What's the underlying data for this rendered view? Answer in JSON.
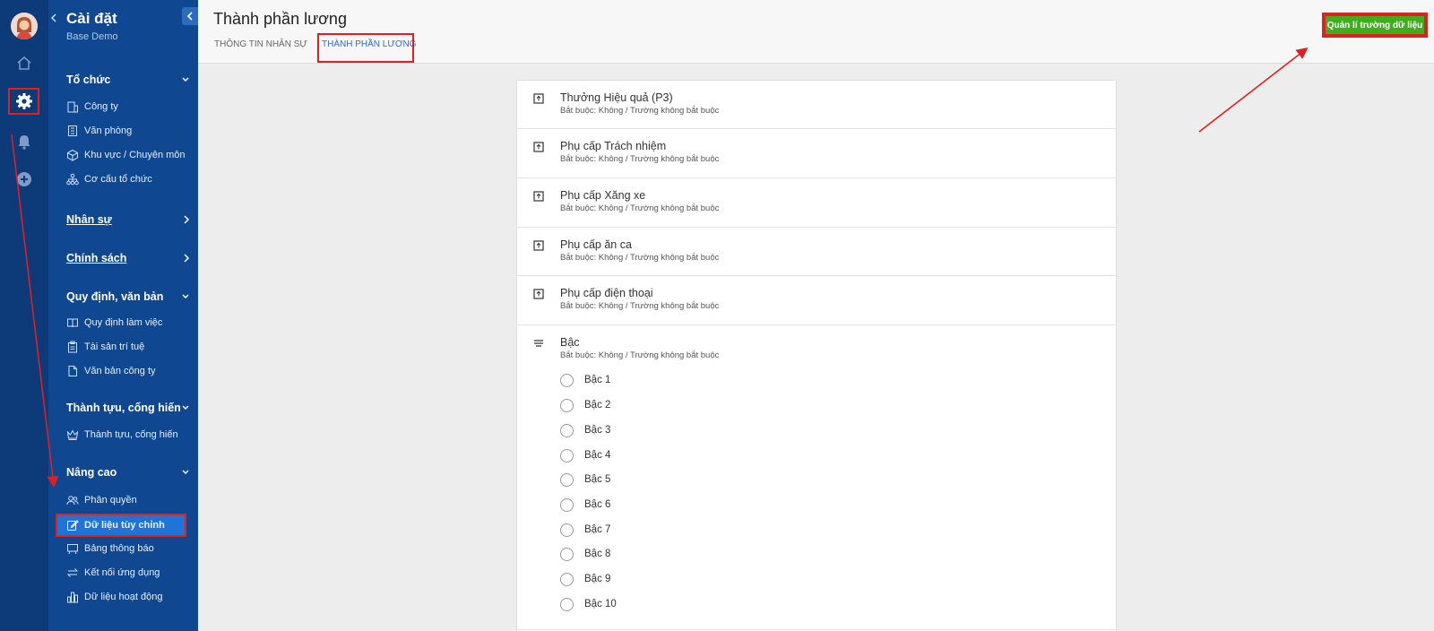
{
  "colors": {
    "rail": "#0d3b7a",
    "sidebar": "#0f4790",
    "accent": "#1e74d8",
    "button": "#3fae1b",
    "highlight": "#e02020"
  },
  "rail": {
    "icons": [
      "avatar",
      "home-icon",
      "gear-icon",
      "bell-icon",
      "plus-circle-icon"
    ]
  },
  "sidebar": {
    "title": "Cài đặt",
    "subtitle": "Base Demo",
    "sections": {
      "org": {
        "label": "Tổ chức",
        "items": [
          "Công ty",
          "Văn phòng",
          "Khu vực / Chuyên môn",
          "Cơ cấu tổ chức"
        ]
      },
      "hr": {
        "label": "Nhân sự"
      },
      "policy": {
        "label": "Chính sách"
      },
      "rules": {
        "label": "Quy định, văn bản",
        "items": [
          "Quy định làm việc",
          "Tài sản trí tuệ",
          "Văn bản công ty"
        ]
      },
      "achieve": {
        "label": "Thành tựu, cống hiến",
        "items": [
          "Thành tựu, cống hiến"
        ]
      },
      "advanced": {
        "label": "Nâng cao",
        "items": [
          "Phân quyền",
          "Dữ liệu tùy chỉnh",
          "Bảng thông báo",
          "Kết nối ứng dụng",
          "Dữ liệu hoạt động"
        ]
      }
    }
  },
  "header": {
    "title": "Thành phần lương",
    "tabs": [
      "THÔNG TIN NHÂN SỰ",
      "THÀNH PHẦN LƯƠNG"
    ],
    "active_tab": "THÀNH PHẦN LƯƠNG",
    "manage_button": "Quản lí trường dữ liệu"
  },
  "fields": [
    {
      "name": "Thưởng Hiệu quả (P3)",
      "sub": "Bắt buộc: Không / Trường không bắt buộc",
      "icon": "number-field-icon"
    },
    {
      "name": "Phụ cấp Trách nhiệm",
      "sub": "Bắt buộc: Không / Trường không bắt buộc",
      "icon": "number-field-icon"
    },
    {
      "name": "Phụ cấp Xăng xe",
      "sub": "Bắt buộc: Không / Trường không bắt buộc",
      "icon": "number-field-icon"
    },
    {
      "name": "Phụ cấp ăn ca",
      "sub": "Bắt buộc: Không / Trường không bắt buộc",
      "icon": "number-field-icon"
    },
    {
      "name": "Phụ cấp điện thoại",
      "sub": "Bắt buộc: Không / Trường không bắt buộc",
      "icon": "number-field-icon"
    },
    {
      "name": "Bậc",
      "sub": "Bắt buộc: Không / Trường không bắt buộc",
      "icon": "list-field-icon",
      "options": [
        "Bậc 1",
        "Bậc 2",
        "Bậc 3",
        "Bậc 4",
        "Bậc 5",
        "Bậc 6",
        "Bậc 7",
        "Bậc 8",
        "Bậc 9",
        "Bậc 10"
      ]
    }
  ]
}
